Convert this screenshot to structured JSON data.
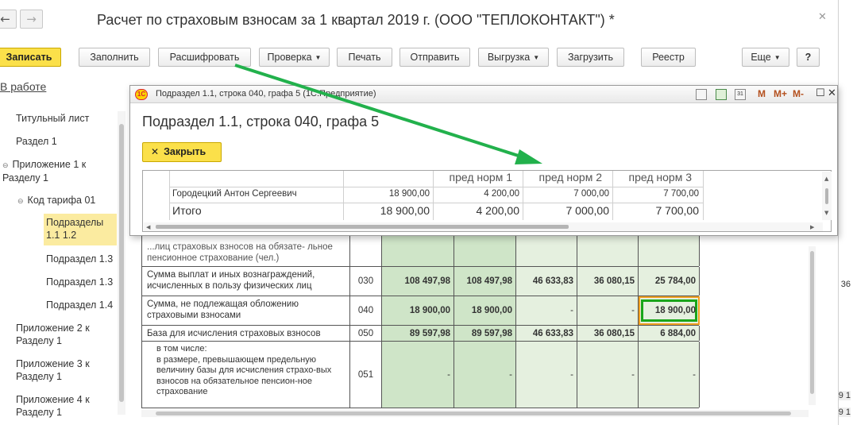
{
  "window": {
    "title": "Расчет по страховым взносам за 1 квартал 2019 г. (ООО \"ТЕПЛОКОНТАКТ\") *",
    "back": "←",
    "forward": "→"
  },
  "toolbar": {
    "save": "Записать",
    "fill": "Заполнить",
    "decode": "Расшифровать",
    "check": "Проверка",
    "print": "Печать",
    "send": "Отправить",
    "export": "Выгрузка",
    "import": "Загрузить",
    "registry": "Реестр",
    "more": "Еще",
    "help": "?"
  },
  "status_link": "В работе",
  "sidebar": {
    "items": [
      {
        "label": "Титульный лист"
      },
      {
        "label": "Раздел 1"
      },
      {
        "label": "Приложение 1 к Разделу 1"
      },
      {
        "label": "Код тарифа 01"
      },
      {
        "label": "Подразделы 1.1 1.2"
      },
      {
        "label": "Подраздел 1.3"
      },
      {
        "label": "Подраздел 1.3"
      },
      {
        "label": "Подраздел 1.4"
      },
      {
        "label": "Приложение 2 к Разделу 1"
      },
      {
        "label": "Приложение 3 к Разделу 1"
      },
      {
        "label": "Приложение 4 к Разделу 1"
      }
    ]
  },
  "popup": {
    "window_title": "Подраздел 1.1, строка 040, графа 5  (1С:Предприятие)",
    "heading": "Подраздел 1.1, строка 040, графа 5",
    "close": "Закрыть",
    "tools": {
      "m": "M",
      "mplus": "M+",
      "mminus": "M-"
    },
    "columns": [
      "",
      "",
      "пред норм 1",
      "пред норм 2",
      "пред норм 3"
    ],
    "rows": [
      {
        "name": "Городецкий Антон Сергеевич",
        "values": [
          "18 900,00",
          "4 200,00",
          "7 000,00",
          "7 700,00"
        ]
      },
      {
        "name": "Итого",
        "values": [
          "18 900,00",
          "4 200,00",
          "7 000,00",
          "7 700,00"
        ]
      }
    ]
  },
  "form_table": {
    "rows": [
      {
        "label": "...лиц страховых взносов на обязате-\nльное пенсионное страхование (чел.)",
        "code": "",
        "values": [
          "",
          "",
          "",
          "",
          ""
        ]
      },
      {
        "label": "Сумма выплат и иных вознаграждений, исчисленных в пользу физических лиц",
        "code": "030",
        "values": [
          "108 497,98",
          "108 497,98",
          "46 633,83",
          "36 080,15",
          "25 784,00"
        ]
      },
      {
        "label": "Сумма, не подлежащая обложению страховыми взносами",
        "code": "040",
        "values": [
          "18 900,00",
          "18 900,00",
          "-",
          "-",
          "18 900,00"
        ]
      },
      {
        "label": "База для исчисления страховых взносов",
        "code": "050",
        "values": [
          "89 597,98",
          "89 597,98",
          "46 633,83",
          "36 080,15",
          "6 884,00"
        ]
      },
      {
        "label": "в том числе:\nв размере, превышающем предельную величину базы для исчисления страхо-вых взносов на обязательное пенсион-ное страхование",
        "code": "051",
        "values": [
          "-",
          "-",
          "-",
          "-",
          "-"
        ]
      }
    ]
  },
  "right_edge": {
    "a": "36",
    "b": "9 1",
    "c": "9 1"
  },
  "colors": {
    "accent_yellow": "#fbe04a",
    "arrow_green": "#22b14c",
    "highlight_green": "#1aa51a",
    "cell_green": "#cfe5c8"
  }
}
